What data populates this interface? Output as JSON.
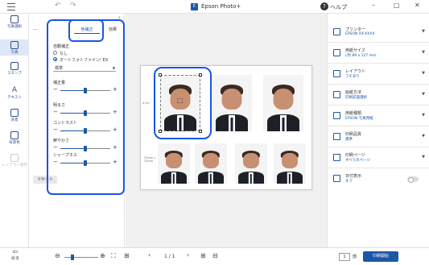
{
  "titlebar": {
    "title": "Epson Photo+",
    "help": "ヘルプ",
    "minimize": "–",
    "maximize": "□",
    "close": "✕"
  },
  "rail": {
    "items": [
      {
        "label": "写真選択"
      },
      {
        "label": "写真"
      },
      {
        "label": "スタンプ"
      },
      {
        "label": "テキスト"
      },
      {
        "label": "背景"
      },
      {
        "label": "背景色"
      },
      {
        "label": "レイアウト保存"
      }
    ]
  },
  "panel": {
    "tab_dots": "---",
    "tabs": [
      "色補正",
      "効果"
    ],
    "auto_correct_label": "自動補正",
    "radio_none": "なし",
    "radio_auto": "オートフォトファイン! EX",
    "select_value": "標準",
    "sliders": [
      "明るさ",
      "コントラスト",
      "鮮やかさ",
      "シャープネス"
    ],
    "top_slider": "補正量",
    "slider_levels": [
      0.5,
      0.5,
      0.5,
      0.5,
      0.5
    ],
    "reset": "リセット"
  },
  "sheet": {
    "left_label_top": "4 cm",
    "left_label_bottom": "30mm x 24mm"
  },
  "right": {
    "items": [
      {
        "title": "プリンター",
        "value": "EPSON XX-XXXX"
      },
      {
        "title": "用紙サイズ",
        "value": "L判 89 x 127 mm"
      },
      {
        "title": "レイアウト",
        "value": "フチあり"
      },
      {
        "title": "給紙方法",
        "value": "印刷前面選択"
      },
      {
        "title": "用紙種類",
        "value": "EPSON 写真用紙"
      },
      {
        "title": "印刷品質",
        "value": "標準"
      },
      {
        "title": "印刷ページ",
        "value": "すべてのページ"
      },
      {
        "title": "日付表示",
        "value": "オフ"
      }
    ]
  },
  "footer": {
    "back": "戻る",
    "page_sep": "1 / 1",
    "copies": "1",
    "copies_unit": "部",
    "print": "印刷開始"
  }
}
